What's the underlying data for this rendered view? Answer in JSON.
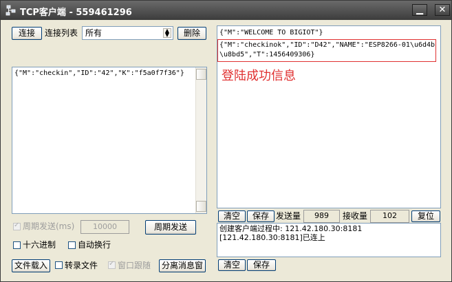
{
  "window": {
    "title": "TCP客户端 - 559461296",
    "minimize": "▁",
    "close": "✕"
  },
  "connection": {
    "connect_label": "连接",
    "list_label": "连接列表",
    "list_selected": "所有",
    "delete_label": "删除"
  },
  "send_box": {
    "text": "{\"M\":\"checkin\",\"ID\":\"42\",\"K\":\"f5a0f7f36\"}"
  },
  "periodic": {
    "checkbox_label": "周期发送(ms)",
    "interval": "10000",
    "button_label": "周期发送"
  },
  "options": {
    "hex_label": "十六进制",
    "auto_newline_label": "自动换行"
  },
  "bottom_left": {
    "load_file": "文件载入",
    "record_file": "转录文件",
    "window_follow": "窗口跟随",
    "separate_window": "分离消息窗"
  },
  "receive_box": {
    "line1": "{\"M\":\"WELCOME TO BIGIOT\"}",
    "line2": "{\"M\":\"checkinok\",\"ID\":\"D42\",\"NAME\":\"ESP8266-01\\u6d4b",
    "line3": "\\u8bd5\",\"T\":1456409306}",
    "annotation": "登陆成功信息",
    "annotation_color": "#e03030"
  },
  "stats": {
    "clear_label": "清空",
    "save_label": "保存",
    "sent_label": "发送量",
    "sent_value": "989",
    "received_label": "接收量",
    "received_value": "102",
    "reset_label": "复位"
  },
  "log_box": {
    "line1": "创建客户端过程中: 121.42.180.30:8181",
    "line2": "[121.42.180.30:8181]已连上",
    "clear_label": "清空",
    "save_label": "保存"
  }
}
